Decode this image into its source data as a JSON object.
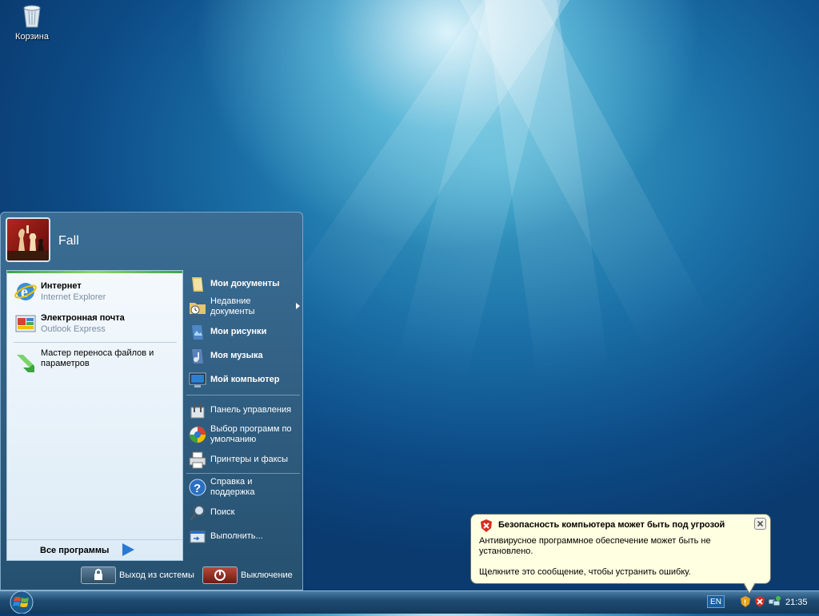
{
  "desktop": {
    "recycle_bin_label": "Корзина"
  },
  "start_menu": {
    "user_name": "Fall",
    "pinned": [
      {
        "title": "Интернет",
        "subtitle": "Internet Explorer",
        "icon": "internet-explorer-icon"
      },
      {
        "title": "Электронная почта",
        "subtitle": "Outlook Express",
        "icon": "outlook-express-icon"
      }
    ],
    "recent": [
      {
        "title": "Мастер переноса файлов и параметров",
        "icon": "transfer-wizard-icon"
      }
    ],
    "all_programs": "Все программы",
    "places": [
      {
        "label": "Мои документы",
        "icon": "my-documents-icon"
      },
      {
        "label": "Недавние документы",
        "icon": "recent-documents-icon"
      },
      {
        "label": "Мои рисунки",
        "icon": "my-pictures-icon"
      },
      {
        "label": "Моя музыка",
        "icon": "my-music-icon"
      },
      {
        "label": "Мой компьютер",
        "icon": "my-computer-icon"
      }
    ],
    "system": [
      {
        "label": "Панель управления",
        "icon": "control-panel-icon"
      },
      {
        "label": "Выбор программ по умолчанию",
        "icon": "default-programs-icon"
      },
      {
        "label": "Принтеры и факсы",
        "icon": "printers-icon"
      }
    ],
    "help": [
      {
        "label": "Справка и поддержка",
        "icon": "help-icon"
      },
      {
        "label": "Поиск",
        "icon": "search-icon"
      },
      {
        "label": "Выполнить...",
        "icon": "run-icon"
      }
    ],
    "logoff": "Выход из системы",
    "shutdown": "Выключение"
  },
  "balloon": {
    "title": "Безопасность компьютера может быть под угрозой",
    "message": "Антивирусное программное обеспечение может быть не установлено.",
    "action": "Щелкните это сообщение, чтобы устранить ошибку."
  },
  "taskbar": {
    "language": "EN",
    "clock": "21:35"
  },
  "colors": {
    "taskbar": "#1f4c73",
    "menu_panel": "#26506f",
    "balloon_bg": "#ffffe1"
  }
}
